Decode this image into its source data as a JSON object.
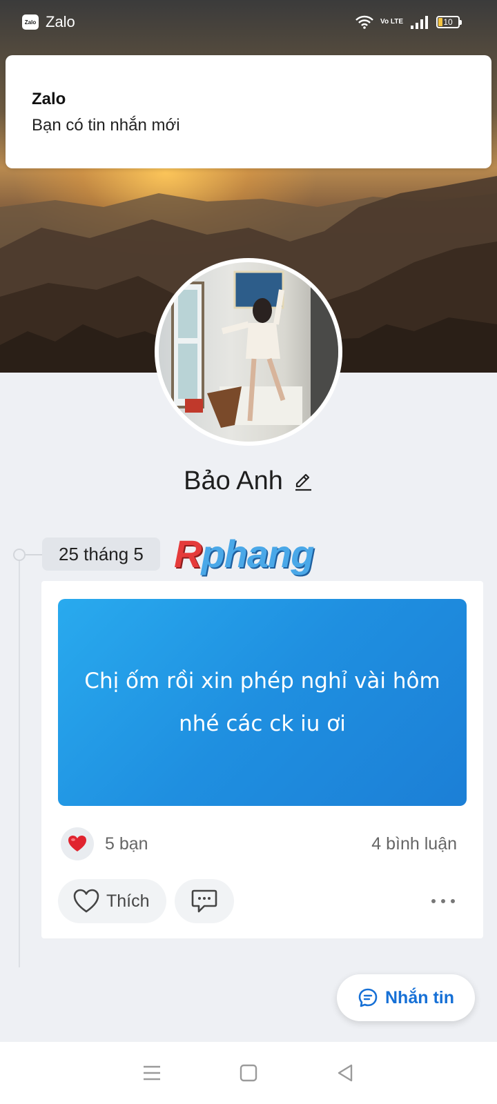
{
  "status_bar": {
    "app_name": "Zalo",
    "app_icon_text": "Zalo",
    "volte": "Vo LTE",
    "battery": "10"
  },
  "notification": {
    "title": "Zalo",
    "body": "Bạn có tin nhắn mới"
  },
  "profile": {
    "name": "Bảo Anh"
  },
  "timeline": {
    "date": "25 tháng 5"
  },
  "watermark": {
    "first": "R",
    "rest": "phang"
  },
  "post": {
    "text": "Chị ốm rồi xin phép nghỉ vài hôm nhé các ck iu ơi",
    "reaction_count": "5 bạn",
    "comment_count": "4 bình luận",
    "like_label": "Thích"
  },
  "actions": {
    "message_label": "Nhắn tin"
  },
  "colors": {
    "post_bg": "#1f8fe0",
    "accent": "#1670d6",
    "heart": "#e0242f"
  }
}
